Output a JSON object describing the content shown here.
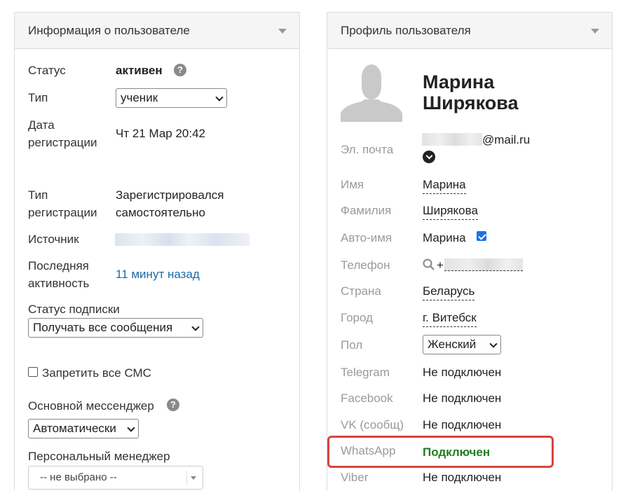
{
  "left_panel": {
    "title": "Информация о пользователе",
    "status_label": "Статус",
    "status_value": "активен",
    "type_label": "Тип",
    "type_select": "ученик",
    "reg_date_label_1": "Дата",
    "reg_date_label_2": "регистрации",
    "reg_date_value": "Чт 21 Мар 20:42",
    "reg_type_label_1": "Тип",
    "reg_type_label_2": "регистрации",
    "reg_type_value_1": "Зарегистрировался",
    "reg_type_value_2": "самостоятельно",
    "source_label": "Источник",
    "last_activity_label_1": "Последняя",
    "last_activity_label_2": "активность",
    "last_activity_value": "11 минут назад",
    "subscription_label": "Статус подписки",
    "subscription_select": "Получать все сообщения",
    "block_sms_label": "Запретить все СМС",
    "block_sms_checked": false,
    "messenger_label": "Основной мессенджер",
    "messenger_select": "Автоматически",
    "manager_label": "Персональный менеджер",
    "manager_select": "-- не выбрано --"
  },
  "right_panel": {
    "title": "Профиль пользователя",
    "name_line_1": "Марина",
    "name_line_2": "Ширякова",
    "email_label": "Эл. почта",
    "email_suffix": "@mail.ru",
    "first_name_label": "Имя",
    "first_name_value": "Марина",
    "last_name_label": "Фамилия",
    "last_name_value": "Ширякова",
    "auto_name_label": "Авто-имя",
    "auto_name_value": "Марина",
    "auto_name_checked": true,
    "phone_label": "Телефон",
    "phone_prefix": "+",
    "country_label": "Страна",
    "country_value": "Беларусь",
    "city_label": "Город",
    "city_value": "г. Витебск",
    "gender_label": "Пол",
    "gender_select": "Женский",
    "telegram_label": "Telegram",
    "telegram_value": "Не подключен",
    "facebook_label": "Facebook",
    "facebook_value": "Не подключен",
    "vk_label": "VK (сообщ)",
    "vk_value": "Не подключен",
    "whatsapp_label": "WhatsApp",
    "whatsapp_value": "Подключен",
    "viber_label": "Viber",
    "viber_value": "Не подключен"
  },
  "colors": {
    "link": "#1a6aa8",
    "connected": "#1e7e1e",
    "highlight": "#d9443f",
    "checkbox": "#1a73e8"
  },
  "icons": [
    "help-icon",
    "caret-down-icon",
    "search-icon",
    "chevron-down-icon",
    "avatar-placeholder"
  ]
}
